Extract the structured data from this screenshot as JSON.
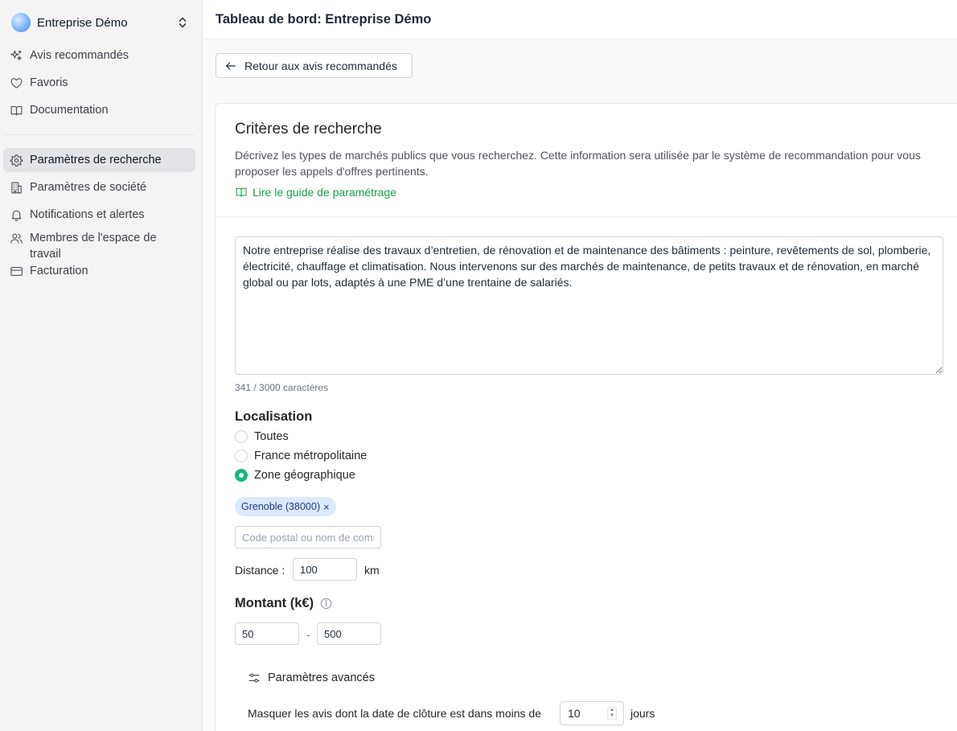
{
  "sidebar": {
    "workspace": {
      "name": "Entreprise Démo"
    },
    "primary": [
      {
        "label": "Avis recommandés",
        "icon": "sparkles-icon"
      },
      {
        "label": "Favoris",
        "icon": "heart-icon"
      },
      {
        "label": "Documentation",
        "icon": "book-icon"
      }
    ],
    "secondary": [
      {
        "label": "Paramètres de recherche",
        "icon": "gear-icon",
        "active": true
      },
      {
        "label": "Paramètres de société",
        "icon": "building-icon"
      },
      {
        "label": "Notifications et alertes",
        "icon": "bell-icon"
      },
      {
        "label": "Membres de l'espace de travail",
        "icon": "users-icon"
      },
      {
        "label": "Facturation",
        "icon": "credit-card-icon"
      }
    ]
  },
  "header": {
    "title": "Tableau de bord: Entreprise Démo"
  },
  "main": {
    "back_label": "Retour aux avis recommandés",
    "card": {
      "title": "Critères de recherche",
      "description": "Décrivez les types de marchés publics que vous recherchez. Cette information sera utilisée par le système de recommandation pour vous proposer les appels d'offres pertinents.",
      "guide_link": "Lire le guide de paramétrage",
      "criteria_text": "Notre entreprise réalise des travaux d’entretien, de rénovation et de maintenance des bâtiments : peinture, revêtements de sol, plomberie, électricité, chauffage et climatisation. Nous intervenons sur des marchés de maintenance, de petits travaux et de rénovation, en marché global ou par lots, adaptés à une PME d’une trentaine de salariés.",
      "char_count": "341 / 3000 caractères",
      "localisation": {
        "title": "Localisation",
        "options": [
          "Toutes",
          "France métropolitaine",
          "Zone géographique"
        ],
        "selected": "Zone géographique",
        "chip": "Grenoble (38000)",
        "chip_remove": "×",
        "search_placeholder": "Code postal ou nom de commune",
        "distance_label": "Distance :",
        "distance_value": "100",
        "distance_unit": "km"
      },
      "montant": {
        "title": "Montant (k€)",
        "min": "50",
        "separator": "-",
        "max": "500"
      },
      "advanced": {
        "title": "Paramètres avancés",
        "closing_label": "Masquer les avis dont la date de clôture est dans moins de",
        "closing_value": "10",
        "closing_unit": "jours"
      }
    }
  },
  "colors": {
    "accent_green": "#10b981",
    "link_green": "#16a34a",
    "chip_bg": "#dbeafe",
    "chip_text": "#1e3a8a"
  }
}
